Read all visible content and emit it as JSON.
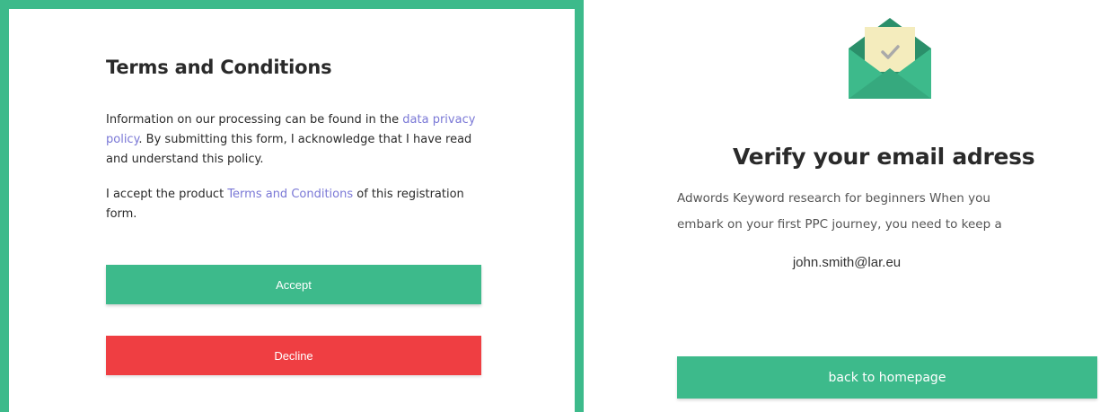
{
  "terms": {
    "title": "Terms and Conditions",
    "para1_before": "Information on our processing can be found in the ",
    "para1_link": "data privacy policy",
    "para1_after": ". By submitting this form, I acknowledge that I have read and understand this policy.",
    "para2_before": "I accept the product ",
    "para2_link": "Terms and Conditions",
    "para2_after": " of this registration form.",
    "accept_label": "Accept",
    "decline_label": "Decline"
  },
  "verify": {
    "icon": "envelope-check-icon",
    "title": "Verify your email adress",
    "body_line1": "Adwords Keyword research for beginners   When you",
    "body_line2": "embark on your first PPC journey, you need to keep a",
    "email": "john.smith@lar.eu",
    "home_button_label": "back to homepage"
  },
  "colors": {
    "accent_green": "#3dba8b",
    "decline_red": "#ef3e42",
    "link_purple": "#7a78d6",
    "envelope_letter": "#f4ecbd",
    "envelope_dark": "#2b8f6a"
  }
}
